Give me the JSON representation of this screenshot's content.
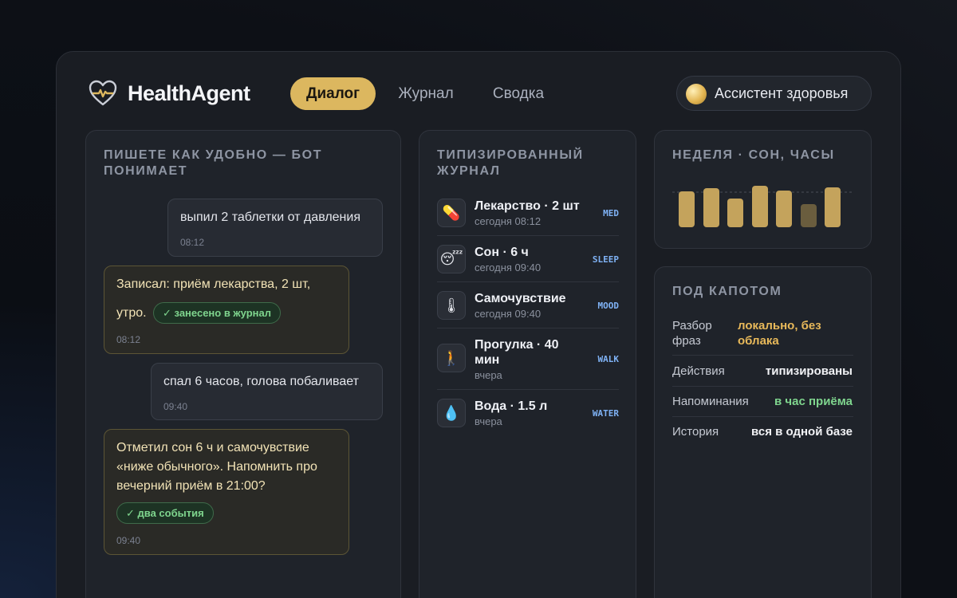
{
  "header": {
    "brand": "HealthAgent",
    "tabs": [
      {
        "label": "Диалог",
        "active": true
      },
      {
        "label": "Журнал",
        "active": false
      },
      {
        "label": "Сводка",
        "active": false
      }
    ],
    "assistant_label": "Ассистент здоровья"
  },
  "chat": {
    "title_line1": "ПИШЕТЕ КАК УДОБНО — БОТ",
    "title_line2": "ПОНИМАЕТ",
    "messages": [
      {
        "role": "user",
        "text": "выпил 2 таблетки от давления",
        "time": "08:12"
      },
      {
        "role": "bot",
        "text_line1": "Записал: приём лекарства, 2 шт,",
        "text_line2": "утро.",
        "chip": "✓ занесено в журнал",
        "time": "08:12"
      },
      {
        "role": "user",
        "text": "спал 6 часов, голова побаливает",
        "time": "09:40"
      },
      {
        "role": "bot",
        "lines": [
          "Отметил сон 6 ч и самочувствие",
          "«ниже обычного». Напомнить про",
          "вечерний приём в 21:00?"
        ],
        "chip": "✓ два события",
        "time": "09:40"
      }
    ]
  },
  "journal": {
    "title_line1": "ТИПИЗИРОВАННЫЙ",
    "title_line2": "ЖУРНАЛ",
    "entries": [
      {
        "icon": "pill-icon",
        "glyph": "💊",
        "title": "Лекарство · 2 шт",
        "sub": "сегодня 08:12",
        "tag": "MED"
      },
      {
        "icon": "sleepy-face-icon",
        "glyph": "😴",
        "title": "Сон · 6 ч",
        "sub": "сегодня 09:40",
        "tag": "SLEEP"
      },
      {
        "icon": "thermometer-icon",
        "glyph": "🌡",
        "title": "Самочувствие",
        "sub": "сегодня 09:40",
        "tag": "MOOD"
      },
      {
        "icon": "walking-person-icon",
        "glyph": "🚶",
        "title_line1": "Прогулка · 40",
        "title_line2": "мин",
        "sub": "вчера",
        "tag": "WALK"
      },
      {
        "icon": "water-drop-icon",
        "glyph": "💧",
        "title": "Вода · 1.5 л",
        "sub": "вчера",
        "tag": "WATER"
      }
    ]
  },
  "week": {
    "title": "НЕДЕЛЯ · СОН, ЧАСЫ",
    "bar_color": "#c4a35c",
    "dim_color": "#6a5d3e",
    "hours": [
      7.0,
      7.6,
      5.6,
      8.1,
      7.2,
      4.5,
      7.8
    ],
    "highlight": [
      true,
      true,
      true,
      true,
      true,
      false,
      true
    ]
  },
  "engine": {
    "title": "ПОД КАПОТОМ",
    "rows": [
      {
        "label_line1": "Разбор",
        "label_line2": "фраз",
        "value_line1": "локально, без",
        "value_line2": "облака",
        "color": "#e8b95a"
      },
      {
        "label": "Действия",
        "value": "типизированы",
        "color": "#f2f3f6"
      },
      {
        "label": "Напоминания",
        "value": "в час приёма",
        "color": "#7fd58e"
      },
      {
        "label": "История",
        "value": "вся в одной базе",
        "color": "#f2f3f6"
      }
    ]
  }
}
